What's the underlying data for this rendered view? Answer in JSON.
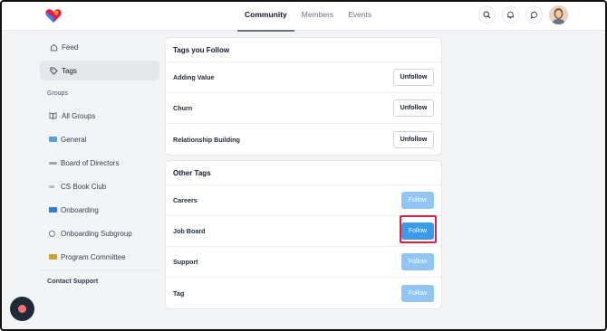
{
  "header": {
    "nav_tabs": [
      {
        "label": "Community",
        "active": true
      },
      {
        "label": "Members",
        "active": false
      },
      {
        "label": "Events",
        "active": false
      }
    ],
    "icons": [
      "search-icon",
      "bell-icon",
      "chat-icon"
    ]
  },
  "sidebar": {
    "items": [
      {
        "label": "Feed",
        "icon": "home-icon"
      },
      {
        "label": "Tags",
        "icon": "tag-icon",
        "active": true
      }
    ],
    "groups_label": "Groups",
    "all_groups": {
      "label": "All Groups",
      "icon": "book-icon"
    },
    "groups": [
      {
        "label": "General",
        "color": "#5aa0d8"
      },
      {
        "label": "Board of Directors",
        "color": "#9ca3af"
      },
      {
        "label": "CS Book Club",
        "color": "#b8bcc4"
      },
      {
        "label": "Onboarding",
        "color": "#3a7bd5"
      },
      {
        "label": "Onboarding Subgroup",
        "color": "#6b7280"
      },
      {
        "label": "Program Committee",
        "color": "#caa03c"
      }
    ],
    "contact_support": "Contact Support"
  },
  "following": {
    "title": "Tags you Follow",
    "button_label": "Unfollow",
    "tags": [
      "Adding Value",
      "Churn",
      "Relationship Building"
    ]
  },
  "other": {
    "title": "Other Tags",
    "button_label": "Follow",
    "tags": [
      "Careers",
      "Job Board",
      "Support",
      "Tag"
    ],
    "highlighted_tag": "Job Board"
  },
  "colors": {
    "accent": "#3b9be8",
    "follow_light": "#93c5f3",
    "highlight": "#e11d48"
  }
}
